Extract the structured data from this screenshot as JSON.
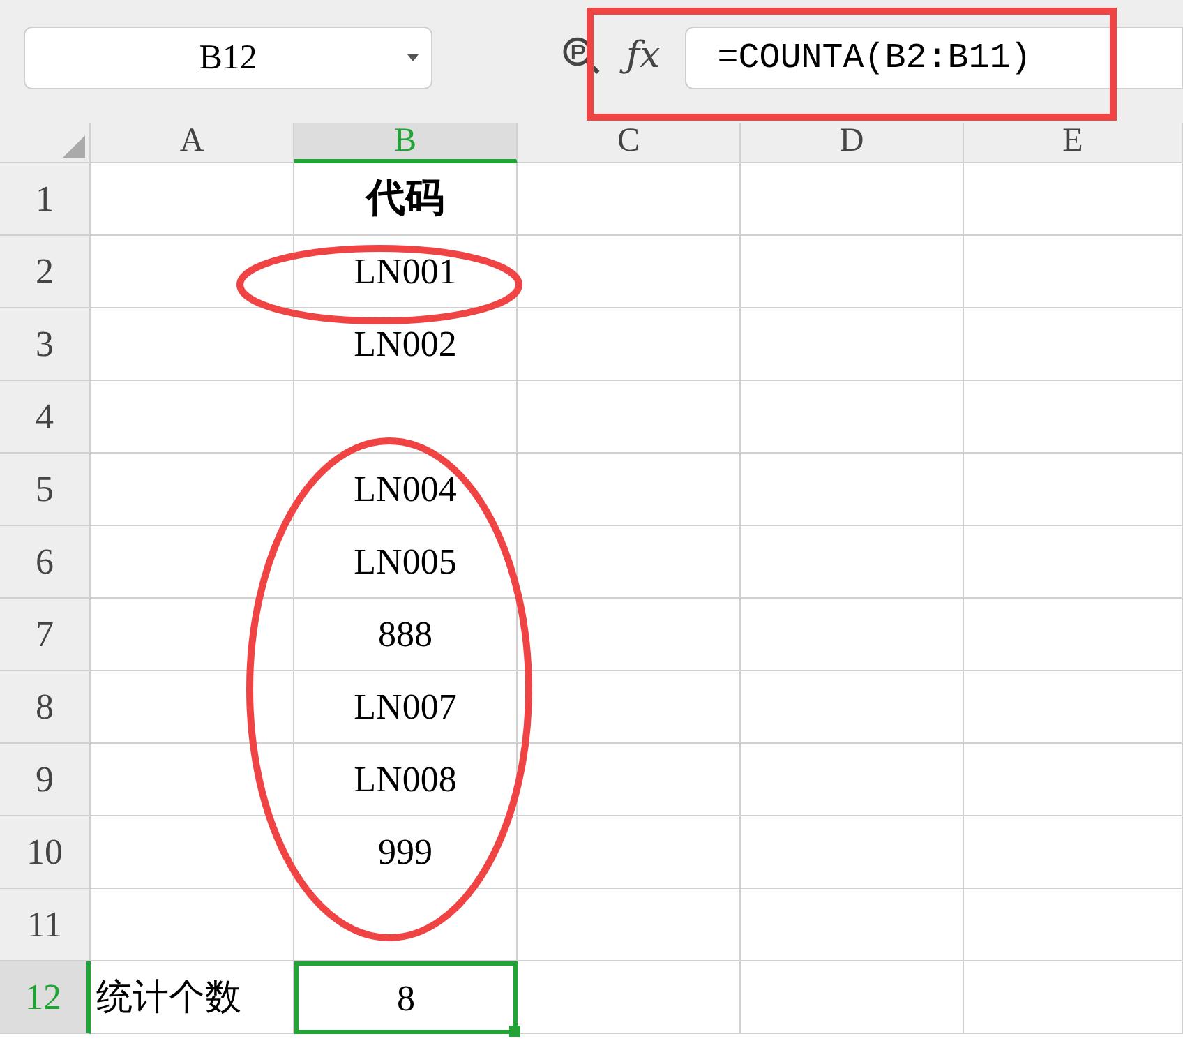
{
  "name_box": {
    "value": "B12"
  },
  "formula_bar": {
    "fx_label": "ƒx",
    "value": "=COUNTA(B2:B11)"
  },
  "columns": [
    {
      "label": "A",
      "selected": false
    },
    {
      "label": "B",
      "selected": true
    },
    {
      "label": "C",
      "selected": false
    },
    {
      "label": "D",
      "selected": false
    },
    {
      "label": "E",
      "selected": false
    }
  ],
  "rows": [
    {
      "label": "1",
      "selected": false,
      "header": true,
      "b": "代码"
    },
    {
      "label": "2",
      "selected": false,
      "header": false,
      "b": "LN001"
    },
    {
      "label": "3",
      "selected": false,
      "header": false,
      "b": "LN002"
    },
    {
      "label": "4",
      "selected": false
    },
    {
      "label": "5",
      "selected": false,
      "header": false,
      "b": "LN004"
    },
    {
      "label": "6",
      "selected": false,
      "header": false,
      "b": "LN005"
    },
    {
      "label": "7",
      "selected": false,
      "header": false,
      "b": "888"
    },
    {
      "label": "8",
      "selected": false,
      "header": false,
      "b": "LN007"
    },
    {
      "label": "9",
      "selected": false,
      "header": false,
      "b": "LN008"
    },
    {
      "label": "10",
      "selected": false,
      "header": false,
      "b": "999"
    },
    {
      "label": "11",
      "selected": false
    },
    {
      "label": "12",
      "selected": true,
      "header": false,
      "a": "统计个数",
      "b": "8"
    }
  ]
}
